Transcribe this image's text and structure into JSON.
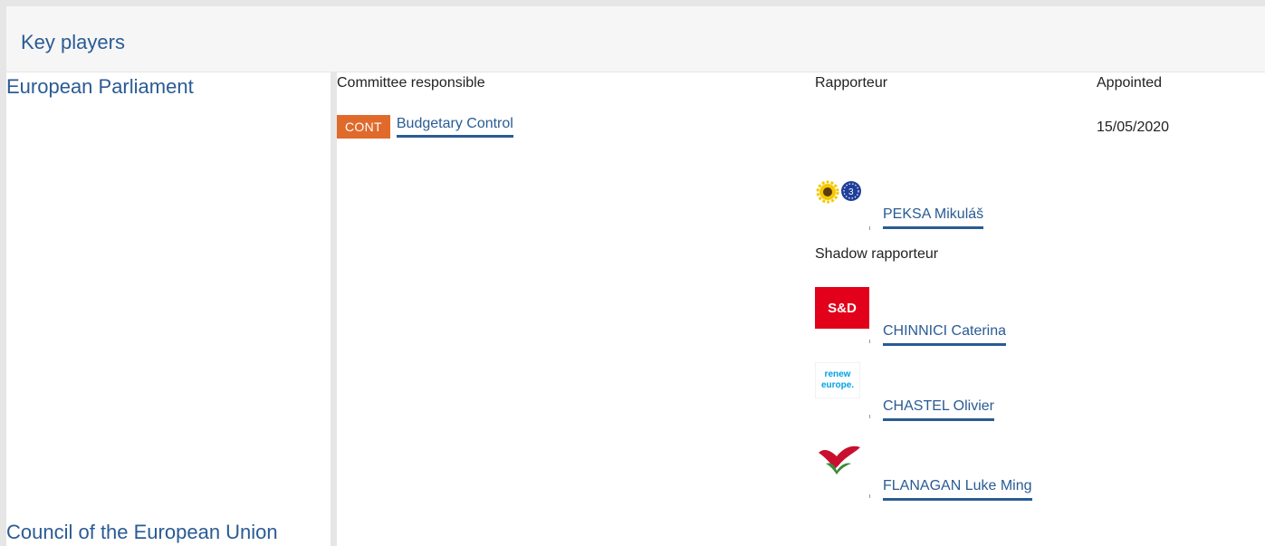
{
  "header": {
    "title": "Key players"
  },
  "sections": {
    "parliament": "European Parliament",
    "council": "Council of the European Union"
  },
  "columns": {
    "committee": "Committee responsible",
    "rapporteur": "Rapporteur",
    "appointed": "Appointed"
  },
  "committee": {
    "badge": "CONT",
    "name": "Budgetary Control",
    "appointed": "15/05/2020",
    "badge_color": "#e06a2b"
  },
  "rapporteur": {
    "name": "PEKSA Mikuláš",
    "group_icon": "greens-efa-logo"
  },
  "shadow_label": "Shadow rapporteur",
  "shadows": [
    {
      "name": "CHINNICI Caterina",
      "group_icon": "s-and-d-logo",
      "logo_text": "S&D"
    },
    {
      "name": "CHASTEL Olivier",
      "group_icon": "renew-europe-logo",
      "logo_text_1": "renew",
      "logo_text_2": "europe."
    },
    {
      "name": "FLANAGAN Luke Ming",
      "group_icon": "gue-ngl-logo"
    }
  ],
  "colors": {
    "link": "#2a5b94",
    "badge": "#e06a2b",
    "sd_red": "#e2001a",
    "renew_blue": "#00a2e5"
  }
}
